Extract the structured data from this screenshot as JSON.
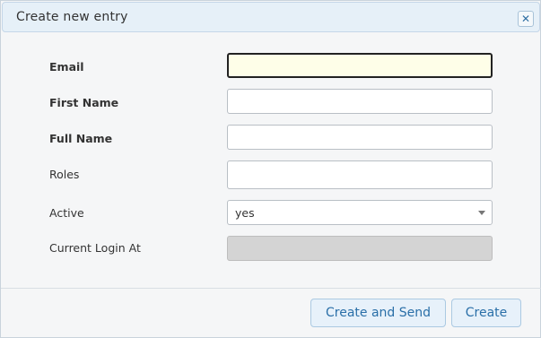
{
  "dialog": {
    "title": "Create new entry",
    "close_icon": "close-icon"
  },
  "form": {
    "fields": [
      {
        "label": "Email",
        "value": "",
        "state": "focused"
      },
      {
        "label": "First Name",
        "value": ""
      },
      {
        "label": "Full Name",
        "value": ""
      },
      {
        "label": "Roles",
        "value": ""
      },
      {
        "label": "Active",
        "value": "yes"
      },
      {
        "label": "Current Login At",
        "value": "",
        "state": "disabled"
      }
    ]
  },
  "buttons": {
    "create_and_send": "Create and Send",
    "create": "Create"
  }
}
